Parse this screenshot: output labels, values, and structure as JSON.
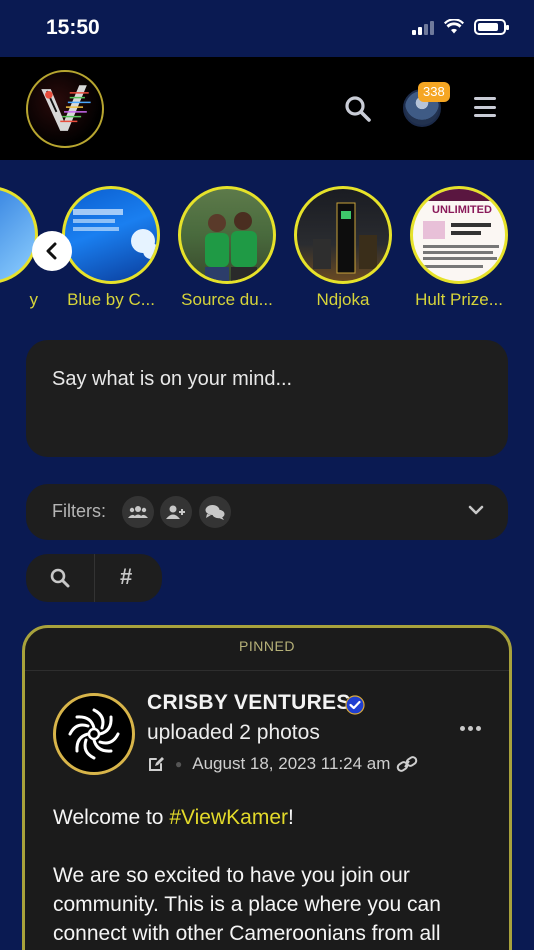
{
  "status_bar": {
    "time": "15:50"
  },
  "header": {
    "notification_count": "338"
  },
  "stories": [
    {
      "label": "y"
    },
    {
      "label": "Blue by C..."
    },
    {
      "label": "Source du..."
    },
    {
      "label": "Ndjoka"
    },
    {
      "label": "Hult Prize..."
    }
  ],
  "composer": {
    "placeholder": "Say what is on your mind..."
  },
  "filters": {
    "label": "Filters:"
  },
  "tools": {
    "hash_label": "#"
  },
  "post": {
    "pinned_label": "PINNED",
    "author": "CRISBY VENTURES",
    "action": "uploaded 2 photos",
    "date": "August 18, 2023 11:24 am",
    "body_prefix": "Welcome to ",
    "hashtag": "#ViewKamer",
    "body_suffix": "!",
    "paragraph2": "We are so excited to have you join our community. This is a place where you can connect with other Cameroonians from all"
  },
  "colors": {
    "background": "#0a1a52",
    "accent_yellow": "#e6e22a",
    "badge": "#f5a623",
    "verified": "#1f3fd1"
  }
}
